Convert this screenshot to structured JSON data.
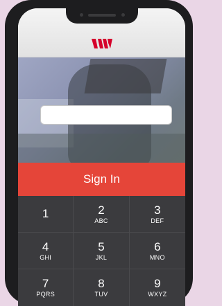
{
  "app": {
    "brand_color": "#d5002b",
    "sign_in_label": "Sign In",
    "sign_in_color": "#e54539"
  },
  "login": {
    "input_value": "",
    "input_placeholder": ""
  },
  "keypad": {
    "keys": [
      {
        "num": "1",
        "letters": ""
      },
      {
        "num": "2",
        "letters": "ABC"
      },
      {
        "num": "3",
        "letters": "DEF"
      },
      {
        "num": "4",
        "letters": "GHI"
      },
      {
        "num": "5",
        "letters": "JKL"
      },
      {
        "num": "6",
        "letters": "MNO"
      },
      {
        "num": "7",
        "letters": "PQRS"
      },
      {
        "num": "8",
        "letters": "TUV"
      },
      {
        "num": "9",
        "letters": "WXYZ"
      }
    ]
  }
}
